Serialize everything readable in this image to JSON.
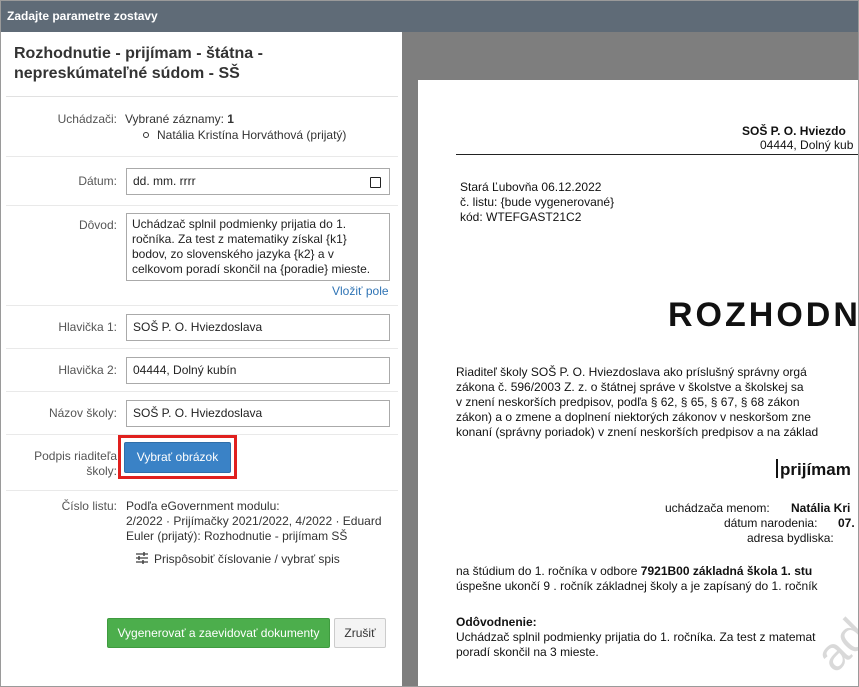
{
  "window": {
    "title": "Zadajte parametre zostavy"
  },
  "form": {
    "title": "Rozhodnutie - prijímam - štátna - nepreskúmateľné súdom - SŠ",
    "applicants": {
      "label": "Uchádzači:",
      "selected_prefix": "Vybrané záznamy:",
      "selected_count": "1",
      "items": [
        "Natália Kristína Horváthová (prijatý)"
      ]
    },
    "date": {
      "label": "Dátum:",
      "placeholder": "dd. mm. rrrr"
    },
    "reason": {
      "label": "Dôvod:",
      "value": "Uchádzač splnil podmienky prijatia do 1. ročníka. Za test z matematiky získal {k1} bodov, zo slovenského jazyka {k2} a v celkovom poradí skončil na {poradie} mieste.",
      "insert_link": "Vložiť pole"
    },
    "header1": {
      "label": "Hlavička 1:",
      "value": "SOŠ P. O. Hviezdoslava"
    },
    "header2": {
      "label": "Hlavička 2:",
      "value": "04444, Dolný kubín"
    },
    "school": {
      "label": "Názov školy:",
      "value": "SOŠ P. O. Hviezdoslava"
    },
    "signature": {
      "label_line1": "Podpis riaditeľa",
      "label_line2": "školy:",
      "button": "Vybrať obrázok"
    },
    "letter_no": {
      "label": "Číslo listu:",
      "line1": "Podľa eGovernment modulu:",
      "line2": "2/2022 · Prijímačky 2021/2022, 4/2022 · Eduard",
      "line3": "Euler (prijatý): Rozhodnutie - prijímam SŠ",
      "customize": "Prispôsobiť číslovanie / vybrať spis"
    },
    "buttons": {
      "generate": "Vygenerovať a zaevidovať dokumenty",
      "cancel": "Zrušiť"
    }
  },
  "preview": {
    "header_line1": "SOŠ P. O. Hviezdo",
    "header_line2": "04444, Dolný kub",
    "place_date": "Stará Ľubovňa 06.12.2022",
    "letter_no": "č. listu: {bude vygenerované}",
    "code": "kód: WTEFGAST21C2",
    "heading": "ROZHODN",
    "para1": [
      "Riaditeľ školy SOŠ P. O. Hviezdoslava ako príslušný správny orgá",
      "zákona č. 596/2003 Z. z. o štátnej správe v školstve a školskej sa",
      "v znení neskorších predpisov, podľa § 62, § 65, § 67, § 68 zákon",
      "zákon) a o zmene a doplnení niektorých zákonov v neskoršom zne",
      "konaní (správny poriadok) v znení neskorších predpisov a na základ"
    ],
    "subheading": "prijímam",
    "applicant_label": "uchádzača menom:",
    "applicant_name": "Natália Kri",
    "birth_label": "dátum narodenia:",
    "birth_value": "07.",
    "address_label": "adresa bydliska:",
    "study_prefix": "na štúdium do 1. ročníka v odbore",
    "study_bold": "7921B00 základná škola 1. stu",
    "study_line2": "úspešne ukončí 9 . ročník základnej školy a je zapísaný do 1. ročník",
    "justification_title": "Odôvodnenie:",
    "justification_line1": "Uchádzač splnil podmienky prijatia do 1. ročníka. Za test z matemat",
    "justification_line2": "poradí skončil na 3 mieste.",
    "watermark": "ad"
  }
}
